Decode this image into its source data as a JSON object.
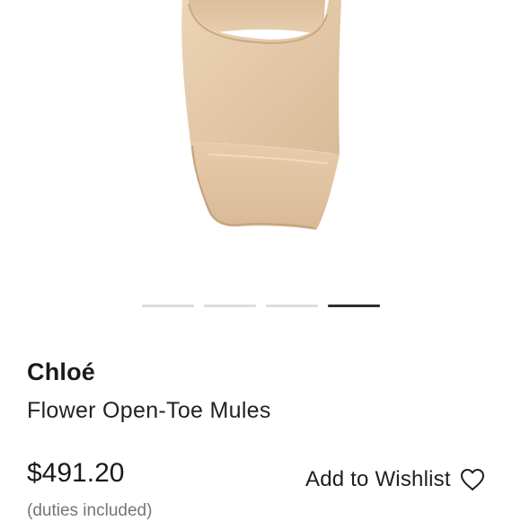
{
  "product_image": {
    "icon": "mule-sandal-photo",
    "slides_total": 4,
    "active_slide": 4
  },
  "product": {
    "brand": "Chloé",
    "name": "Flower Open-Toe Mules",
    "price": "$491.20",
    "price_note": "(duties included)"
  },
  "wishlist": {
    "label": "Add to Wishlist",
    "icon": "heart-outline-icon"
  },
  "colors": {
    "active_dot": "#2e2e2e",
    "inactive_dot": "#dddddd",
    "text_muted": "#757575"
  }
}
